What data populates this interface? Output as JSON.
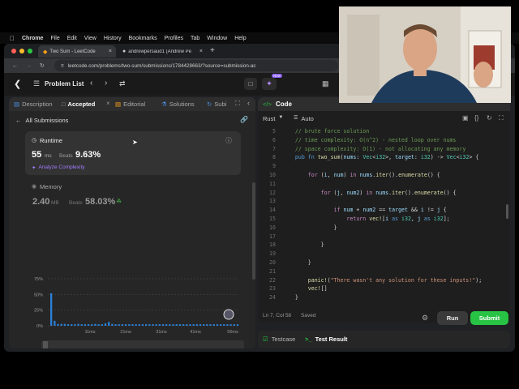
{
  "macos_menu": {
    "app": "Chrome",
    "items": [
      "File",
      "Edit",
      "View",
      "History",
      "Bookmarks",
      "Profiles",
      "Tab",
      "Window",
      "Help"
    ]
  },
  "browser": {
    "tabs": [
      {
        "label": "Two Sum - LeetCode",
        "active": true
      },
      {
        "label": "andrewpersaud1 (Andrew Pe",
        "active": false
      }
    ],
    "new_tab": "+",
    "url": "leetcode.com/problems/two-sum/submissions/1784428663/?source=submission-ac"
  },
  "lc_top": {
    "problem_list": "Problem List",
    "premium_badge": "New"
  },
  "left_tabs": {
    "description": "Description",
    "accepted": "Accepted",
    "editorial": "Editorial",
    "solutions": "Solutions",
    "submissions": "Subi"
  },
  "submission": {
    "back": "All Submissions",
    "runtime_title": "Runtime",
    "runtime_value": "55",
    "runtime_unit": "ms",
    "beats_label": "Beats",
    "runtime_beats": "9.63%",
    "analyze": "Analyze Complexity",
    "memory_title": "Memory",
    "memory_value": "2.40",
    "memory_unit": "MB",
    "memory_beats": "58.03%"
  },
  "chart_data": {
    "type": "bar",
    "ytick_labels": [
      "75%",
      "50%",
      "25%",
      "0%"
    ],
    "yticks": [
      75,
      50,
      25,
      0
    ],
    "ylim": [
      0,
      75
    ],
    "xtick_labels": [
      "11ms",
      "21ms",
      "31ms",
      "41ms",
      "56ms"
    ],
    "values": [
      52,
      8,
      3,
      3,
      3,
      2.5,
      2.5,
      2.5,
      3,
      2.5,
      2.5,
      2.5,
      2.5,
      3,
      2.5,
      2.5,
      4,
      6,
      3,
      2.5,
      2.5,
      2.5,
      2.5,
      2.5,
      2.5,
      2.5,
      2.5,
      2.5,
      2.5,
      2.5,
      2.5,
      2.5,
      2.5,
      2.5,
      2.5,
      2.5,
      2.5,
      2.5,
      2.5,
      2.5,
      2.5,
      2.5,
      2.5,
      2.5,
      2.5,
      2.5,
      2.5,
      2.5,
      2.5,
      2.5,
      2.5,
      2.5,
      2.5,
      2.5,
      2.5,
      2.5
    ],
    "bar_color": "#2b7fd6",
    "range_xtick_labels": [
      "11ms",
      "21ms",
      "31ms",
      "42ms",
      "56ms"
    ]
  },
  "editor": {
    "title": "Code",
    "language": "Rust",
    "mode": "Auto",
    "lines": [
      {
        "n": "5",
        "html": "    <span class='cmt'>// brute force solution</span>"
      },
      {
        "n": "6",
        "html": "    <span class='cmt'>// time complexity: O(n^2) - nested loop over nums</span>"
      },
      {
        "n": "7",
        "html": "    <span class='cmt'>// space complexity: O(1) - not allocating any memory</span>"
      },
      {
        "n": "8",
        "html": "    <span class='kw2'>pub fn</span> <span class='fn'>two_sum</span><span class='pl'>(</span><span class='var'>nums</span><span class='pl'>: </span><span class='ty'>Vec</span><span class='pl'>&lt;</span><span class='ty'>i32</span><span class='pl'>&gt;, </span><span class='var'>target</span><span class='pl'>: </span><span class='ty'>i32</span><span class='pl'>) -&gt; </span><span class='ty'>Vec</span><span class='pl'>&lt;</span><span class='ty'>i32</span><span class='pl'>&gt; {</span>"
      },
      {
        "n": "9",
        "html": ""
      },
      {
        "n": "10",
        "html": "        <span class='kw'>for</span> <span class='pl'>(</span><span class='var'>i</span><span class='pl'>, </span><span class='var'>num</span><span class='pl'>) </span><span class='kw'>in</span> <span class='var'>nums</span><span class='pl'>.</span><span class='fn'>iter</span><span class='pl'>().</span><span class='fn'>enumerate</span><span class='pl'>() {</span>"
      },
      {
        "n": "11",
        "html": ""
      },
      {
        "n": "12",
        "html": "            <span class='kw'>for</span> <span class='pl'>(</span><span class='var'>j</span><span class='pl'>, </span><span class='var'>num2</span><span class='pl'>) </span><span class='kw'>in</span> <span class='var'>nums</span><span class='pl'>.</span><span class='fn'>iter</span><span class='pl'>().</span><span class='fn'>enumerate</span><span class='pl'>() {</span>"
      },
      {
        "n": "13",
        "html": ""
      },
      {
        "n": "14",
        "html": "                <span class='kw'>if</span> <span class='var'>num</span> <span class='pl'>+</span> <span class='var'>num2</span> <span class='pl'>==</span> <span class='var'>target</span> <span class='pl'>&amp;&amp;</span> <span class='var'>i</span> <span class='pl'>!=</span> <span class='var'>j</span> <span class='pl'>{</span>"
      },
      {
        "n": "15",
        "html": "                    <span class='kw'>return</span> <span class='fn'>vec!</span><span class='pl'>[</span><span class='var'>i</span> <span class='kw2'>as</span> <span class='ty'>i32</span><span class='pl'>, </span><span class='var'>j</span> <span class='kw2'>as</span> <span class='ty'>i32</span><span class='pl'>];</span>"
      },
      {
        "n": "16",
        "html": "                <span class='pl'>}</span>"
      },
      {
        "n": "17",
        "html": ""
      },
      {
        "n": "18",
        "html": "            <span class='pl'>}</span>"
      },
      {
        "n": "19",
        "html": ""
      },
      {
        "n": "20",
        "html": "        <span class='pl'>}</span>"
      },
      {
        "n": "21",
        "html": ""
      },
      {
        "n": "22",
        "html": "        <span class='fn'>panic!</span><span class='pl'>(</span><span class='str'>\"There wasn't any solution for these inputs!\"</span><span class='pl'>);</span>"
      },
      {
        "n": "23",
        "html": "        <span class='fn'>vec!</span><span class='pl'>[]</span>"
      },
      {
        "n": "24",
        "html": "    <span class='pl'>}</span>"
      }
    ],
    "status_pos": "Ln 7, Col 58",
    "status_saved": "Saved",
    "run_label": "Run",
    "submit_label": "Submit"
  },
  "bottom": {
    "testcase": "Testcase",
    "test_result": "Test Result"
  }
}
